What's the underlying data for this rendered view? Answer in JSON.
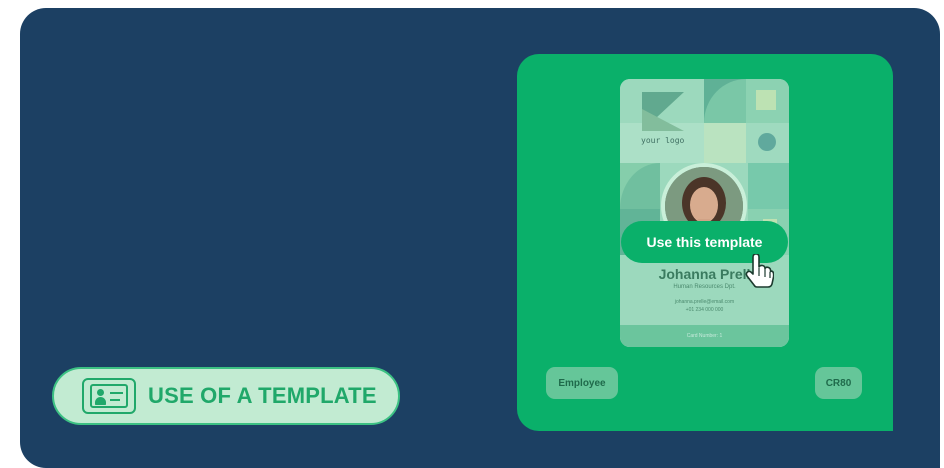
{
  "feature": {
    "label": "USE OF A TEMPLATE",
    "icon": "id-card-icon"
  },
  "template_card": {
    "logo_text": "your logo",
    "name": "Johanna Prell",
    "department": "Human Resources Dpt.",
    "email": "johanna.prelle@email.com",
    "phone": "+01 234 000 000",
    "footer": "Card Number: 1"
  },
  "cta": {
    "label": "Use this template",
    "cursor_icon": "hand-pointer-icon"
  },
  "tags": {
    "category": "Employee",
    "format": "CR80"
  },
  "colors": {
    "panel": "#1c4063",
    "preview": "#0ab06a",
    "accent": "#20a86a",
    "pill_bg": "#c2ebd2"
  }
}
